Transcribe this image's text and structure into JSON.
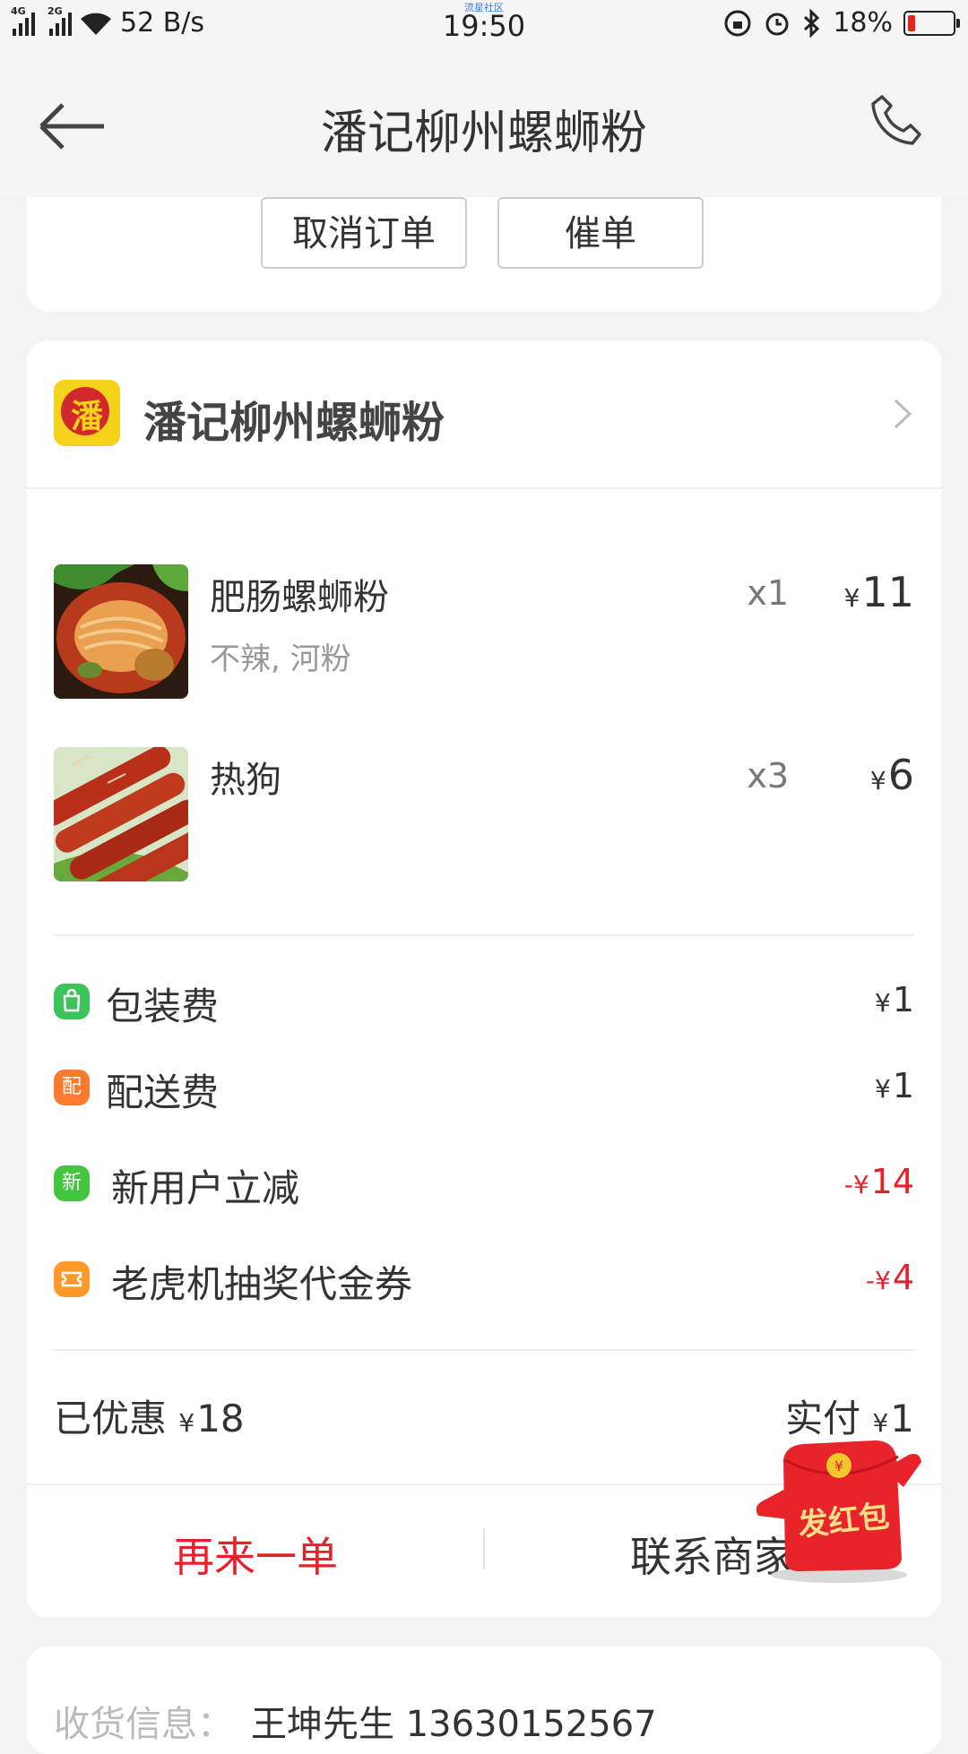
{
  "status_bar": {
    "network1": "4G",
    "network2": "2G",
    "speed": "52 B/s",
    "carrier_label": "流星社区",
    "time": "19:50",
    "battery": "18%",
    "battery_level": 0.18
  },
  "header": {
    "title": "潘记柳州螺蛳粉",
    "back_icon": "arrow-left-icon",
    "phone_icon": "phone-icon"
  },
  "order_actions": {
    "cancel_label": "取消订单",
    "urge_label": "催单"
  },
  "shop": {
    "name": "潘记柳州螺蛳粉",
    "logo_char": "潘"
  },
  "items": [
    {
      "name": "肥肠螺蛳粉",
      "spec": "不辣, 河粉",
      "qty": "x1",
      "currency": "¥",
      "price": "11"
    },
    {
      "name": "热狗",
      "spec": "",
      "qty": "x3",
      "currency": "¥",
      "price": "6"
    }
  ],
  "fees": [
    {
      "icon": "bag-icon",
      "icon_text": "",
      "color": "#3cc35a",
      "label": "包装费",
      "currency": "¥",
      "value": "1",
      "discount": false
    },
    {
      "icon": "delivery-icon",
      "icon_text": "配",
      "color": "#ff7a2f",
      "label": "配送费",
      "currency": "¥",
      "value": "1",
      "discount": false
    },
    {
      "icon": "new-user-icon",
      "icon_text": "新",
      "color": "#44c53e",
      "label": "新用户立减",
      "currency": "-¥",
      "value": "14",
      "discount": true
    },
    {
      "icon": "coupon-icon",
      "icon_text": "",
      "color": "#ff9a2a",
      "label": "老虎机抽奖代金券",
      "currency": "-¥",
      "value": "4",
      "discount": true
    }
  ],
  "summary": {
    "saved_label": "已优惠",
    "saved_currency": "¥",
    "saved_value": "18",
    "paid_label": "实付",
    "paid_currency": "¥",
    "paid_value": "1"
  },
  "bottom_actions": {
    "reorder_label": "再来一单",
    "contact_label": "联系商家"
  },
  "red_packet": {
    "label": "发红包"
  },
  "delivery": {
    "label": "收货信息：",
    "value": "王坤先生  13630152567"
  },
  "colors": {
    "accent_red": "#e8202c"
  }
}
